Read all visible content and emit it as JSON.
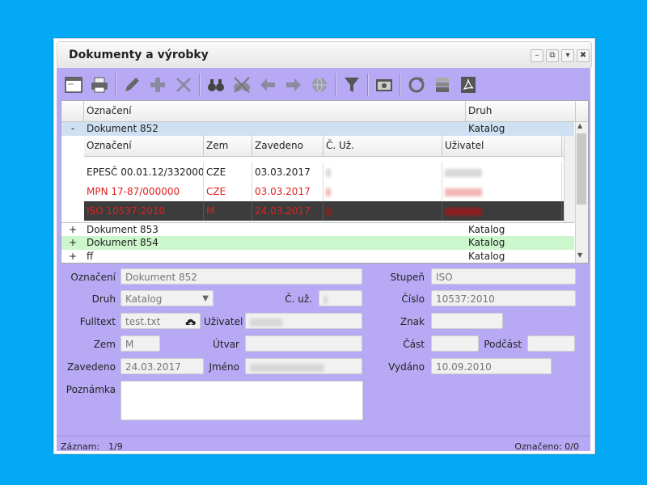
{
  "window": {
    "title": "Dokumenty a výrobky"
  },
  "grid": {
    "headers": {
      "oznaceni": "Označení",
      "druh": "Druh"
    },
    "expanded": {
      "toggle": "-",
      "name": "Dokument 852",
      "druh": "Katalog"
    },
    "sub_headers": {
      "oznaceni": "Označení",
      "zem": "Zem",
      "zavedeno": "Zavedeno",
      "c_uz": "Č. Už.",
      "uzivatel": "Uživatel"
    },
    "sub_rows": [
      {
        "oznaceni": "EPESČ 00.01.12/332000",
        "zem": "CZE",
        "zavedeno": "03.03.2017"
      },
      {
        "oznaceni": "MPN 17-87/000000",
        "zem": "CZE",
        "zavedeno": "03.03.2017"
      },
      {
        "oznaceni": "ISO 10537:2010",
        "zem": "M",
        "zavedeno": "24.03.2017"
      }
    ],
    "rows": [
      {
        "toggle": "+",
        "name": "Dokument 853",
        "druh": "Katalog"
      },
      {
        "toggle": "+",
        "name": "Dokument 854",
        "druh": "Katalog"
      },
      {
        "toggle": "+",
        "name": "ff",
        "druh": "Katalog"
      }
    ]
  },
  "form": {
    "oznaceni_label": "Označení",
    "oznaceni_value": "Dokument 852",
    "druh_label": "Druh",
    "druh_value": "Katalog",
    "cuz_label": "Č. už.",
    "fulltext_label": "Fulltext",
    "fulltext_value": "test.txt",
    "uzivatel_label": "Uživatel",
    "zem_label": "Zem",
    "zem_value": "M",
    "utvar_label": "Útvar",
    "zavedeno_label": "Zavedeno",
    "zavedeno_value": "24.03.2017",
    "jmeno_label": "Jméno",
    "poznamka_label": "Poznámka",
    "stupen_label": "Stupeň",
    "stupen_value": "ISO",
    "cislo_label": "Číslo",
    "cislo_value": "10537:2010",
    "znak_label": "Znak",
    "cast_label": "Část",
    "podcast_label": "Podčást",
    "vydano_label": "Vydáno",
    "vydano_value": "10.09.2010"
  },
  "status": {
    "zaznam_label": "Záznam:",
    "zaznam_value": "1/9",
    "oznaceno": "Označeno: 0/0"
  },
  "colors": {
    "accent": "#b8a9f5",
    "background": "#03a9f4",
    "selected_row": "#3c3c3c",
    "error_text": "#e02020",
    "expanded_row": "#cfe0f3",
    "highlight_row": "#ccf7cc"
  }
}
